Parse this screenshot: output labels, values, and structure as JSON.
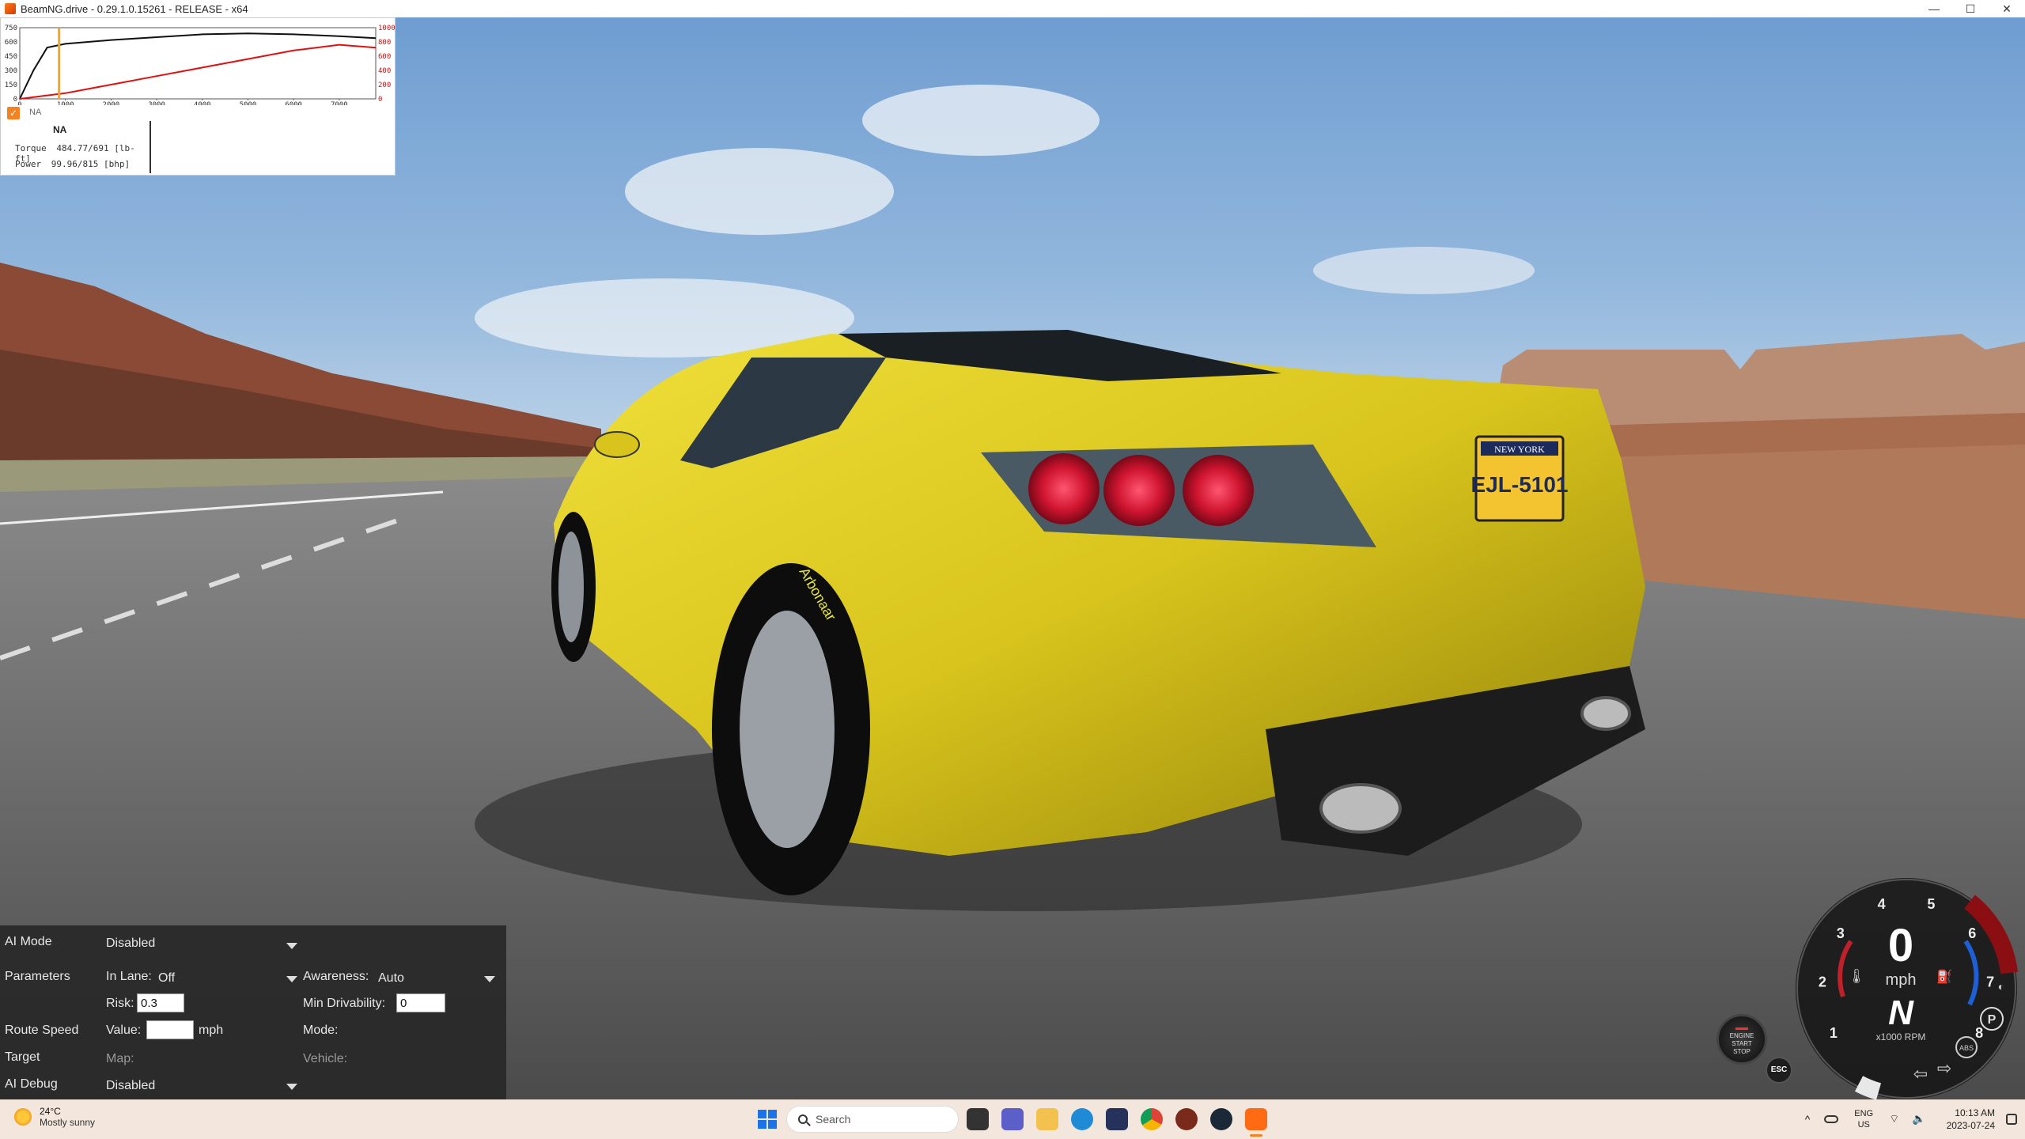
{
  "window": {
    "title": "BeamNG.drive - 0.29.1.0.15261 - RELEASE - x64",
    "controls": {
      "minimize": "—",
      "maximize": "☐",
      "close": "✕"
    }
  },
  "graph": {
    "left_ticks": [
      "750",
      "600",
      "450",
      "300",
      "150",
      "0"
    ],
    "right_ticks": [
      "1000",
      "800",
      "600",
      "400",
      "200",
      "0"
    ],
    "x_ticks": [
      "0",
      "1000",
      "2000",
      "3000",
      "4000",
      "5000",
      "6000",
      "7000"
    ],
    "series_colors": {
      "torque": "#111111",
      "power": "#e01010",
      "marker": "#f5a623"
    },
    "checkbox_label": "NA",
    "legend_title": "NA",
    "torque_label": "Torque",
    "torque_value": "484.77/691 [lb-ft]",
    "power_label": "Power",
    "power_value": "99.96/815 [bhp]"
  },
  "ai_panel": {
    "ai_mode_label": "AI Mode",
    "ai_mode_value": "Disabled",
    "parameters_label": "Parameters",
    "in_lane_label": "In Lane:",
    "in_lane_value": "Off",
    "awareness_label": "Awareness:",
    "awareness_value": "Auto",
    "risk_label": "Risk:",
    "risk_value": "0.3",
    "min_drivability_label": "Min Drivability:",
    "min_drivability_value": "0",
    "route_speed_label": "Route Speed",
    "value_label": "Value:",
    "value_value": "",
    "value_unit": "mph",
    "mode_label": "Mode:",
    "target_label": "Target",
    "map_label": "Map:",
    "vehicle_label": "Vehicle:",
    "ai_debug_label": "AI Debug",
    "ai_debug_value": "Disabled"
  },
  "dashboard": {
    "speed": "0",
    "speed_unit": "mph",
    "gear": "N",
    "rpm_unit": "x1000 RPM",
    "rpm_ticks": [
      "1",
      "2",
      "3",
      "4",
      "5",
      "6",
      "7",
      "8"
    ],
    "park_indicator": "P",
    "abs_indicator": "ABS",
    "engine_button_line1": "ENGINE",
    "engine_button_line2": "START",
    "engine_button_line3": "STOP",
    "esc_button": "ESC"
  },
  "scene": {
    "license_plate_state": "NEW YORK",
    "license_plate_number": "EJL-5101",
    "tire_brand": "Arbonaar"
  },
  "taskbar": {
    "weather_temp": "24°C",
    "weather_desc": "Mostly sunny",
    "search_placeholder": "Search",
    "tray_chevron": "^",
    "lang_line1": "ENG",
    "lang_line2": "US",
    "time": "10:13 AM",
    "date": "2023-07-24",
    "sys_icons": "⌔ 🔈"
  }
}
